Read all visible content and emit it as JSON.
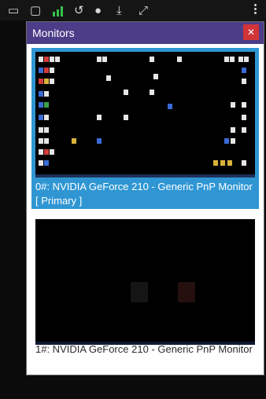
{
  "panel": {
    "title": "Monitors",
    "close_icon": "close-icon"
  },
  "monitors": [
    {
      "label": "0#: NVIDIA GeForce 210  - Generic PnP Monitor [ Primary ]",
      "selected": true
    },
    {
      "label": "1#: NVIDIA GeForce 210  - Generic PnP Monitor",
      "selected": false
    }
  ],
  "topbar": {
    "icons": [
      "taskbar-icon-2",
      "chat-icon",
      "signal-bars-icon",
      "restore-icon",
      "record-dot-icon",
      "download-icon",
      "expand-icon",
      "more-options-icon"
    ]
  },
  "accent": "#2f96d3",
  "titlebar_color": "#4c3d89",
  "close_color": "#d13438"
}
